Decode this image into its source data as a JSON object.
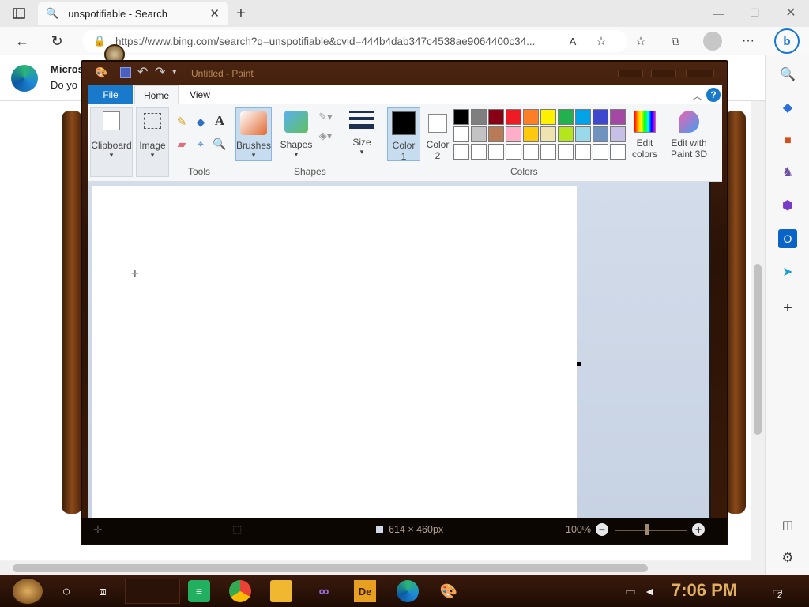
{
  "browser": {
    "tab_title": "unspotifiable - Search",
    "url": "https://www.bing.com/search?q=unspotifiable&cvid=444b4dab347c4538ae9064400c34...",
    "banner_title": "Micros",
    "banner_sub": "Do yo"
  },
  "paint": {
    "title": "Untitled - Paint",
    "tabs": [
      "File",
      "Home",
      "View"
    ],
    "groups": {
      "clipboard": "Clipboard",
      "image": "Image",
      "tools": "Tools",
      "brushes": "Brushes",
      "shapes_btn": "Shapes",
      "shapes_group": "Shapes",
      "size": "Size",
      "color1_line1": "Color",
      "color1_line2": "1",
      "color2_line1": "Color",
      "color2_line2": "2",
      "edit_colors_line1": "Edit",
      "edit_colors_line2": "colors",
      "edit3d_line1": "Edit with",
      "edit3d_line2": "Paint 3D",
      "colors_group": "Colors"
    },
    "palette": {
      "row1": [
        "#000000",
        "#7f7f7f",
        "#880015",
        "#ed1c24",
        "#ff7f27",
        "#fff200",
        "#22b14c",
        "#00a2e8",
        "#3f48cc",
        "#a349a4"
      ],
      "row2": [
        "#ffffff",
        "#c3c3c3",
        "#b97a57",
        "#ffaec9",
        "#ffc90e",
        "#efe4b0",
        "#b5e61d",
        "#99d9ea",
        "#7092be",
        "#c8bfe7"
      ],
      "row3": [
        "#ffffff",
        "#ffffff",
        "#ffffff",
        "#ffffff",
        "#ffffff",
        "#ffffff",
        "#ffffff",
        "#ffffff",
        "#ffffff",
        "#ffffff"
      ]
    },
    "status": {
      "dimensions": "614 × 460px",
      "zoom": "100%"
    }
  },
  "taskbar": {
    "time": "7:06 PM",
    "notification_count": "2"
  }
}
